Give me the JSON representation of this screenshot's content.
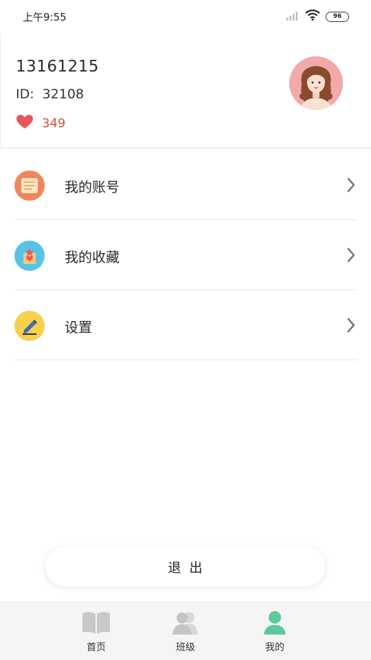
{
  "status_bar": {
    "time": "上午9:55",
    "battery": "96"
  },
  "profile": {
    "username": "13161215",
    "id_label": "ID:",
    "id_value": "32108",
    "likes": "349"
  },
  "menu": {
    "items": [
      {
        "label": "我的账号",
        "icon": "account-icon",
        "color": "#f0875a"
      },
      {
        "label": "我的收藏",
        "icon": "favorites-icon",
        "color": "#58c3e8"
      },
      {
        "label": "设置",
        "icon": "settings-pencil-icon",
        "color": "#f7d14d"
      }
    ]
  },
  "logout": {
    "label": "退出"
  },
  "tabbar": {
    "tabs": [
      {
        "label": "首页",
        "icon": "book-icon",
        "active": false
      },
      {
        "label": "班级",
        "icon": "class-icon",
        "active": false
      },
      {
        "label": "我的",
        "icon": "person-icon",
        "active": true
      }
    ]
  },
  "colors": {
    "accent": "#5cc99a",
    "like": "#e8565f",
    "likes_text": "#d0543e",
    "inactive_icon": "#c8c8c8"
  }
}
